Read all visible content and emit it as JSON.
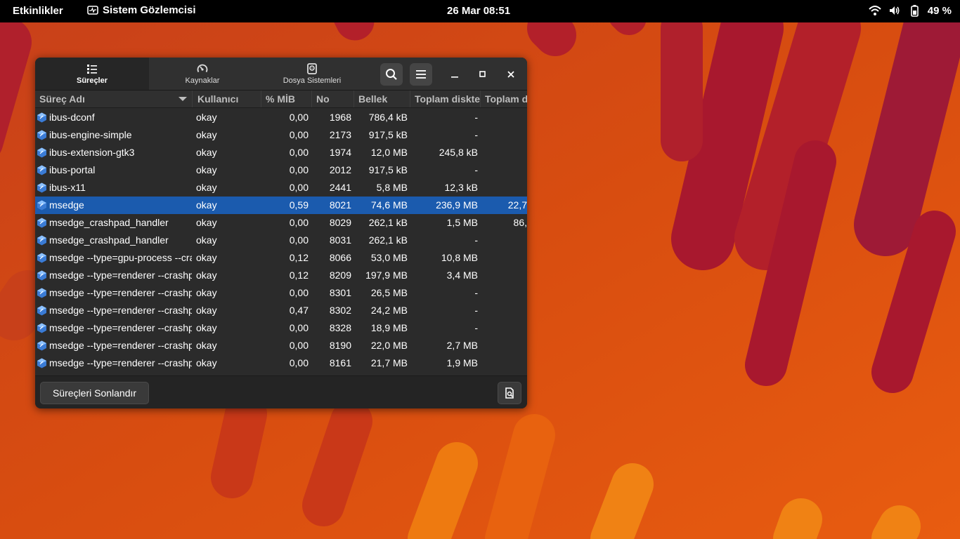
{
  "topbar": {
    "activities": "Etkinlikler",
    "app_name": "Sistem Gözlemcisi",
    "clock": "26 Mar  08:51",
    "battery": "49 %"
  },
  "window": {
    "tabs": [
      {
        "label": "Süreçler",
        "icon": "list-icon"
      },
      {
        "label": "Kaynaklar",
        "icon": "gauge-icon"
      },
      {
        "label": "Dosya Sistemleri",
        "icon": "disk-icon"
      }
    ],
    "columns": [
      "Süreç Adı",
      "Kullanıcı",
      "% MİB",
      "No",
      "Bellek",
      "Toplam diskte",
      "Toplam d"
    ],
    "rows": [
      {
        "name": "ibus-dconf",
        "user": "okay",
        "cpu": "0,00",
        "id": "1968",
        "mem": "786,4 kB",
        "disk": "-",
        "disk2": ""
      },
      {
        "name": "ibus-engine-simple",
        "user": "okay",
        "cpu": "0,00",
        "id": "2173",
        "mem": "917,5 kB",
        "disk": "-",
        "disk2": ""
      },
      {
        "name": "ibus-extension-gtk3",
        "user": "okay",
        "cpu": "0,00",
        "id": "1974",
        "mem": "12,0 MB",
        "disk": "245,8 kB",
        "disk2": ""
      },
      {
        "name": "ibus-portal",
        "user": "okay",
        "cpu": "0,00",
        "id": "2012",
        "mem": "917,5 kB",
        "disk": "-",
        "disk2": ""
      },
      {
        "name": "ibus-x11",
        "user": "okay",
        "cpu": "0,00",
        "id": "2441",
        "mem": "5,8 MB",
        "disk": "12,3 kB",
        "disk2": ""
      },
      {
        "name": "msedge",
        "user": "okay",
        "cpu": "0,59",
        "id": "8021",
        "mem": "74,6 MB",
        "disk": "236,9 MB",
        "disk2": "22,7"
      },
      {
        "name": "msedge_crashpad_handler",
        "user": "okay",
        "cpu": "0,00",
        "id": "8029",
        "mem": "262,1 kB",
        "disk": "1,5 MB",
        "disk2": "86,"
      },
      {
        "name": "msedge_crashpad_handler",
        "user": "okay",
        "cpu": "0,00",
        "id": "8031",
        "mem": "262,1 kB",
        "disk": "-",
        "disk2": ""
      },
      {
        "name": "msedge --type=gpu-process --crashpad",
        "user": "okay",
        "cpu": "0,12",
        "id": "8066",
        "mem": "53,0 MB",
        "disk": "10,8 MB",
        "disk2": ""
      },
      {
        "name": "msedge --type=renderer --crashpad",
        "user": "okay",
        "cpu": "0,12",
        "id": "8209",
        "mem": "197,9 MB",
        "disk": "3,4 MB",
        "disk2": ""
      },
      {
        "name": "msedge --type=renderer --crashpad",
        "user": "okay",
        "cpu": "0,00",
        "id": "8301",
        "mem": "26,5 MB",
        "disk": "-",
        "disk2": ""
      },
      {
        "name": "msedge --type=renderer --crashpad",
        "user": "okay",
        "cpu": "0,47",
        "id": "8302",
        "mem": "24,2 MB",
        "disk": "-",
        "disk2": ""
      },
      {
        "name": "msedge --type=renderer --crashpad",
        "user": "okay",
        "cpu": "0,00",
        "id": "8328",
        "mem": "18,9 MB",
        "disk": "-",
        "disk2": ""
      },
      {
        "name": "msedge --type=renderer --crashpad",
        "user": "okay",
        "cpu": "0,00",
        "id": "8190",
        "mem": "22,0 MB",
        "disk": "2,7 MB",
        "disk2": ""
      },
      {
        "name": "msedge --type=renderer --crashpad",
        "user": "okay",
        "cpu": "0,00",
        "id": "8161",
        "mem": "21,7 MB",
        "disk": "1,9 MB",
        "disk2": ""
      }
    ],
    "selected_row": 5,
    "end_button": "Süreçleri Sonlandır"
  },
  "colors": {
    "selection": "#1b5bae",
    "wallpaper_orange": "#e0500f",
    "wallpaper_red": "#a8182e"
  }
}
